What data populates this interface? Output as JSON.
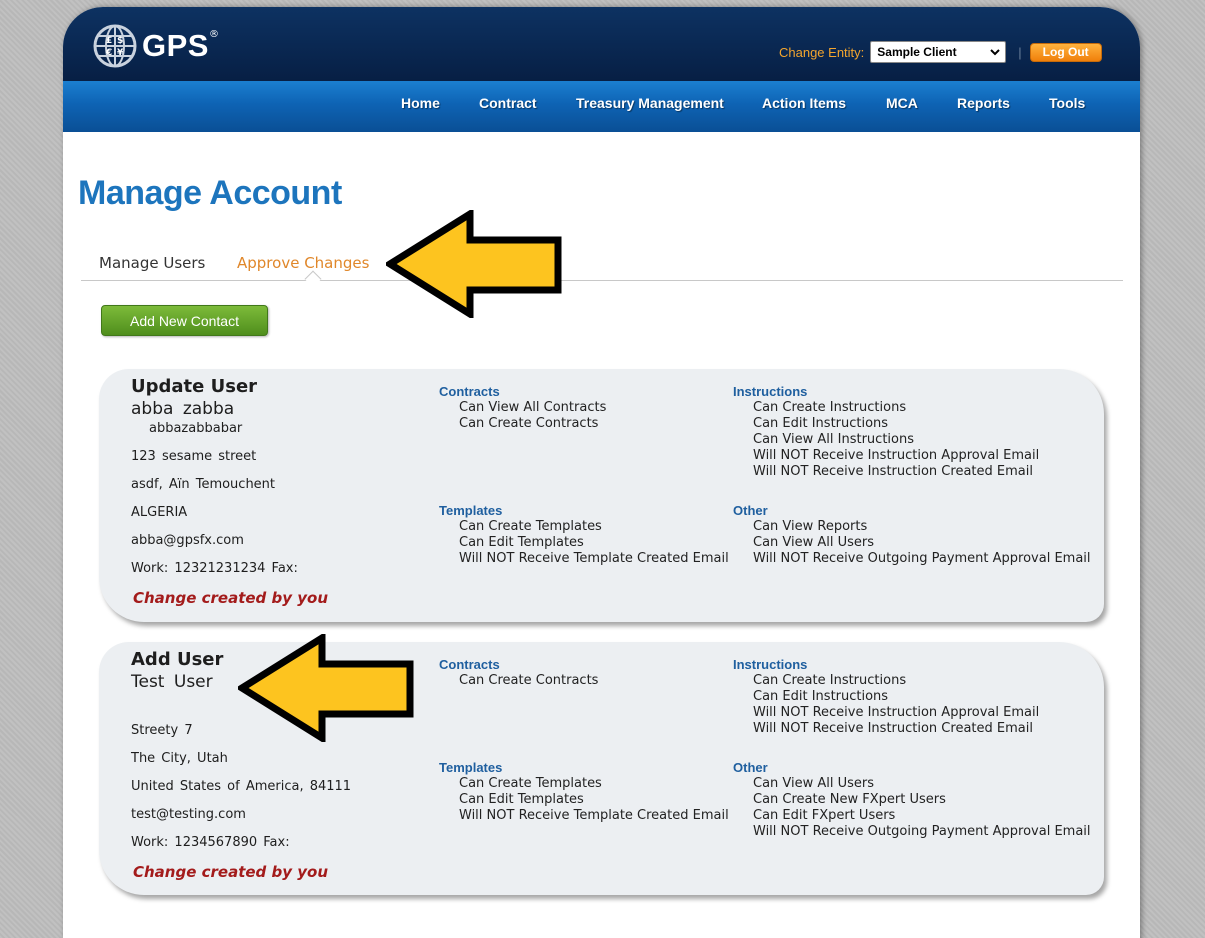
{
  "header": {
    "logo_text": "GPS",
    "logo_reg": "®",
    "change_entity_label": "Change Entity:",
    "entity_selected": "Sample Client",
    "separator": "|",
    "logout_label": "Log Out",
    "accent_color": "#f3a52e"
  },
  "nav": {
    "items": [
      "Home",
      "Contract",
      "Treasury Management",
      "Action Items",
      "MCA",
      "Reports",
      "Tools"
    ]
  },
  "page": {
    "title": "Manage Account",
    "tabs": [
      "Manage Users",
      "Approve Changes"
    ],
    "active_tab": "Approve Changes",
    "add_button": "Add New Contact"
  },
  "changes": [
    {
      "title": "Update User",
      "name": "abba  zabba",
      "username": "abbazabbabar",
      "address_lines": [
        "123 sesame street",
        "asdf,  Aïn Temouchent",
        "ALGERIA",
        "abba@gpsfx.com",
        "Work: 12321231234  Fax:"
      ],
      "change_note": "Change created by you",
      "contracts_heading": "Contracts",
      "contracts": [
        "Can View All Contracts",
        "Can Create Contracts"
      ],
      "templates_heading": "Templates",
      "templates": [
        "Can Create Templates",
        "Can Edit Templates",
        "Will NOT Receive Template Created Email"
      ],
      "instructions_heading": "Instructions",
      "instructions": [
        "Can Create Instructions",
        "Can Edit Instructions",
        "Can View All Instructions",
        "Will NOT Receive Instruction Approval Email",
        "Will NOT Receive Instruction Created Email"
      ],
      "other_heading": "Other",
      "other": [
        "Can View Reports",
        "Can View All Users",
        "Will NOT Receive Outgoing Payment Approval Email"
      ]
    },
    {
      "title": "Add User",
      "name": "Test  User",
      "username": "",
      "address_lines": [
        "Streety 7",
        "The City,  Utah",
        "United States of America,  84111",
        "test@testing.com",
        "Work: 1234567890  Fax:"
      ],
      "change_note": "Change created by you",
      "contracts_heading": "Contracts",
      "contracts": [
        "Can Create Contracts"
      ],
      "templates_heading": "Templates",
      "templates": [
        "Can Create Templates",
        "Can Edit Templates",
        "Will NOT Receive Template Created Email"
      ],
      "instructions_heading": "Instructions",
      "instructions": [
        "Can Create Instructions",
        "Can Edit Instructions",
        "Will NOT Receive Instruction Approval Email",
        "Will NOT Receive Instruction Created Email"
      ],
      "other_heading": "Other",
      "other": [
        "Can View All Users",
        "Can Create New FXpert Users",
        "Can Edit FXpert Users",
        "Will NOT Receive Outgoing Payment Approval Email"
      ]
    }
  ],
  "annotation": {
    "arrow_color": "#fdc41f",
    "arrow_outline": "#000000"
  }
}
